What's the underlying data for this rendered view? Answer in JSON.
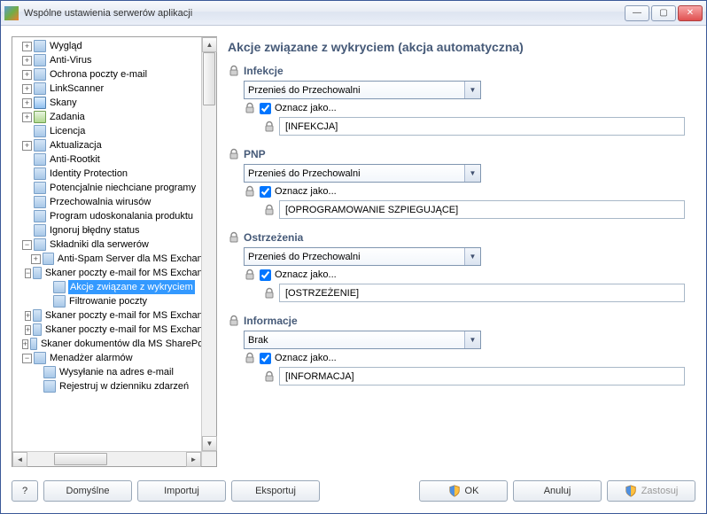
{
  "window": {
    "title": "Wspólne ustawienia serwerów aplikacji"
  },
  "tree": {
    "items": [
      {
        "tw": "plus",
        "indent": 0,
        "icon": "page",
        "label": "Wygląd"
      },
      {
        "tw": "plus",
        "indent": 0,
        "icon": "page",
        "label": "Anti-Virus"
      },
      {
        "tw": "plus",
        "indent": 0,
        "icon": "page",
        "label": "Ochrona poczty e-mail"
      },
      {
        "tw": "plus",
        "indent": 0,
        "icon": "page",
        "label": "LinkScanner"
      },
      {
        "tw": "plus",
        "indent": 0,
        "icon": "scan",
        "label": "Skany"
      },
      {
        "tw": "plus",
        "indent": 0,
        "icon": "task",
        "label": "Zadania"
      },
      {
        "tw": "none",
        "indent": 0,
        "icon": "page",
        "label": "Licencja"
      },
      {
        "tw": "plus",
        "indent": 0,
        "icon": "page",
        "label": "Aktualizacja"
      },
      {
        "tw": "none",
        "indent": 0,
        "icon": "page",
        "label": "Anti-Rootkit"
      },
      {
        "tw": "none",
        "indent": 0,
        "icon": "page",
        "label": "Identity Protection"
      },
      {
        "tw": "none",
        "indent": 0,
        "icon": "page",
        "label": "Potencjalnie niechciane programy"
      },
      {
        "tw": "none",
        "indent": 0,
        "icon": "page",
        "label": "Przechowalnia wirusów"
      },
      {
        "tw": "none",
        "indent": 0,
        "icon": "page",
        "label": "Program udoskonalania produktu"
      },
      {
        "tw": "none",
        "indent": 0,
        "icon": "page",
        "label": "Ignoruj błędny status"
      },
      {
        "tw": "minus",
        "indent": 0,
        "icon": "page",
        "label": "Składniki dla serwerów"
      },
      {
        "tw": "plus",
        "indent": 1,
        "icon": "page",
        "label": "Anti-Spam Server dla MS Exchange"
      },
      {
        "tw": "minus",
        "indent": 1,
        "icon": "page",
        "label": "Skaner poczty e-mail for MS Exchange"
      },
      {
        "tw": "none",
        "indent": 2,
        "icon": "page",
        "label": "Akcje związane z wykryciem",
        "selected": true
      },
      {
        "tw": "none",
        "indent": 2,
        "icon": "page",
        "label": "Filtrowanie poczty"
      },
      {
        "tw": "plus",
        "indent": 1,
        "icon": "page",
        "label": "Skaner poczty e-mail for MS Exchange"
      },
      {
        "tw": "plus",
        "indent": 1,
        "icon": "page",
        "label": "Skaner poczty e-mail for MS Exchange"
      },
      {
        "tw": "plus",
        "indent": 1,
        "icon": "page",
        "label": "Skaner dokumentów dla MS SharePoint"
      },
      {
        "tw": "minus",
        "indent": 0,
        "icon": "page",
        "label": "Menadżer alarmów"
      },
      {
        "tw": "none",
        "indent": 1,
        "icon": "page",
        "label": "Wysyłanie na adres e-mail"
      },
      {
        "tw": "none",
        "indent": 1,
        "icon": "page",
        "label": "Rejestruj w dzienniku zdarzeń"
      }
    ]
  },
  "main": {
    "title": "Akcje związane z wykryciem (akcja automatyczna)",
    "sections": [
      {
        "title": "Infekcje",
        "combo": "Przenieś do Przechowalni",
        "mark_label": "Oznacz jako...",
        "value": "[INFEKCJA]"
      },
      {
        "title": "PNP",
        "combo": "Przenieś do Przechowalni",
        "mark_label": "Oznacz jako...",
        "value": "[OPROGRAMOWANIE SZPIEGUJĄCE]"
      },
      {
        "title": "Ostrzeżenia",
        "combo": "Przenieś do Przechowalni",
        "mark_label": "Oznacz jako...",
        "value": "[OSTRZEŻENIE]"
      },
      {
        "title": "Informacje",
        "combo": "Brak",
        "mark_label": "Oznacz jako...",
        "value": "[INFORMACJA]"
      }
    ]
  },
  "footer": {
    "help_tip": "?",
    "defaults": "Domyślne",
    "importBtn": "Importuj",
    "exportBtn": "Eksportuj",
    "ok": "OK",
    "cancel": "Anuluj",
    "apply": "Zastosuj"
  }
}
